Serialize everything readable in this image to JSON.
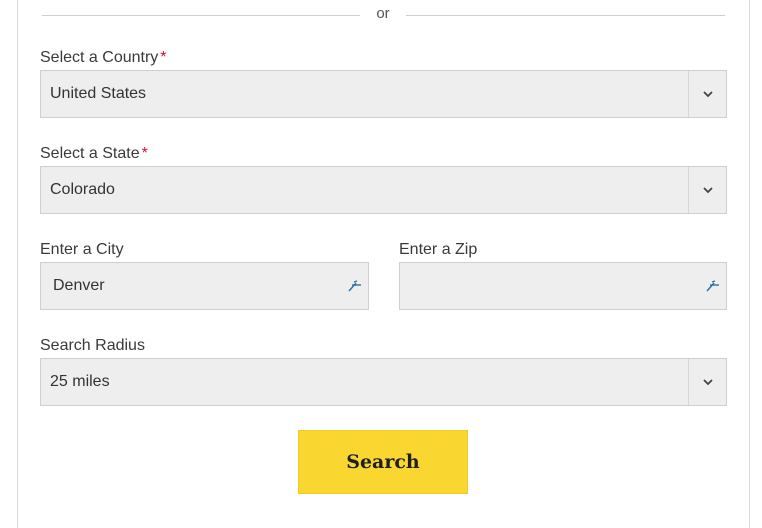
{
  "divider": {
    "text": "or"
  },
  "country": {
    "label": "Select a Country",
    "required_mark": "*",
    "value": "United States",
    "arrow_icon": "chevron-down-icon"
  },
  "state": {
    "label": "Select a State",
    "required_mark": "*",
    "value": "Colorado",
    "arrow_icon": "chevron-down-icon"
  },
  "city": {
    "label": "Enter a City",
    "value": "Denver",
    "icon": "location-arrow-icon"
  },
  "zip": {
    "label": "Enter a Zip",
    "value": "",
    "icon": "location-arrow-icon"
  },
  "radius": {
    "label": "Search Radius",
    "value": "25 miles",
    "arrow_icon": "chevron-down-icon"
  },
  "search_button": {
    "label": "Search"
  },
  "colors": {
    "button_bg": "#fad631",
    "field_bg": "#eeeeee",
    "required": "#c8102e",
    "icon_blue": "#2b6cb0"
  }
}
